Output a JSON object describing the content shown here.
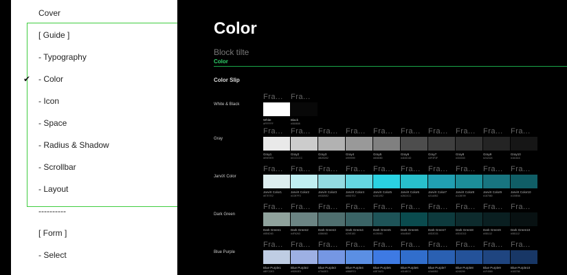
{
  "menu": {
    "items": [
      {
        "label": "Cover",
        "checked": false
      },
      {
        "label": "[ Guide ]",
        "checked": false
      },
      {
        "label": "- Typography",
        "checked": false
      },
      {
        "label": "- Color",
        "checked": true
      },
      {
        "label": "- Icon",
        "checked": false
      },
      {
        "label": "- Space",
        "checked": false
      },
      {
        "label": "- Radius & Shadow",
        "checked": false
      },
      {
        "label": "- Scrollbar",
        "checked": false
      },
      {
        "label": "- Layout",
        "checked": false
      },
      {
        "label": "----------",
        "checked": false
      },
      {
        "label": "[ Form ]",
        "checked": false
      },
      {
        "label": "- Select",
        "checked": false
      }
    ],
    "check_mark": "✔"
  },
  "page": {
    "title": "Color",
    "block_title": "Block tilte",
    "block_subtitle": "Color",
    "section_title": "Color Slip"
  },
  "frame_label": "Fra...",
  "groups": [
    {
      "label": "White & Black",
      "swatches": [
        {
          "name": "White",
          "hex": "#FFFFFF",
          "color": "#FFFFFF"
        },
        {
          "name": "Black",
          "hex": "#080808",
          "color": "#080808"
        }
      ]
    },
    {
      "label": "Gray",
      "swatches": [
        {
          "name": "Gray1",
          "hex": "#E9E9E9",
          "color": "#E9E9E9"
        },
        {
          "name": "Gray2",
          "hex": "#CCCCCC",
          "color": "#CCCCCC"
        },
        {
          "name": "Gray3",
          "hex": "#B2B2B2",
          "color": "#B2B2B2"
        },
        {
          "name": "Gray4",
          "hex": "#999999",
          "color": "#999999"
        },
        {
          "name": "Gray5",
          "hex": "#808080",
          "color": "#808080"
        },
        {
          "name": "Gray6",
          "hex": "#4D4D4D",
          "color": "#4D4D4D"
        },
        {
          "name": "Gray7",
          "hex": "#3F3F3F",
          "color": "#3F3F3F"
        },
        {
          "name": "Gray8",
          "hex": "#333333",
          "color": "#333333"
        },
        {
          "name": "Gray9",
          "hex": "#242424",
          "color": "#242424"
        },
        {
          "name": "Gray10",
          "hex": "#161616",
          "color": "#161616"
        }
      ]
    },
    {
      "label": "JarviX Color",
      "swatches": [
        {
          "name": "JarviX Color1",
          "hex": "#E7E7E2",
          "color": "#DDEEEF"
        },
        {
          "name": "JarviX Color2",
          "hex": "#C0EFF2",
          "color": "#C0EFF2"
        },
        {
          "name": "JarviX Color3",
          "hex": "#93DBE2",
          "color": "#93DBE2"
        },
        {
          "name": "JarviX Color4",
          "hex": "#65D7E2",
          "color": "#65D7E2"
        },
        {
          "name": "JarviX Color5",
          "hex": "#2AD2E2",
          "color": "#2AD2E2"
        },
        {
          "name": "JarviX Color6",
          "hex": "#28C0CC",
          "color": "#28C0CC"
        },
        {
          "name": "JarviX Color7",
          "hex": "#21A0B2",
          "color": "#21A0B2"
        },
        {
          "name": "JarviX Color8",
          "hex": "#1C8E99",
          "color": "#1C8E99"
        },
        {
          "name": "JarviX Color9",
          "hex": "#187580",
          "color": "#187580"
        },
        {
          "name": "JarviX Color10",
          "hex": "#105E66",
          "color": "#105E66"
        }
      ]
    },
    {
      "label": "Dark Green",
      "swatches": [
        {
          "name": "Dark Green1",
          "hex": "#5E6D63",
          "color": "#8FA29C"
        },
        {
          "name": "Dark Green2",
          "hex": "#4F6263",
          "color": "#6B8483"
        },
        {
          "name": "Dark Green3",
          "hex": "#386063",
          "color": "#4F6F6F"
        },
        {
          "name": "Dark Green4",
          "hex": "#20E183",
          "color": "#3A6466"
        },
        {
          "name": "Dark Green5",
          "hex": "#135063",
          "color": "#1E5458"
        },
        {
          "name": "Dark Green6",
          "hex": "#0A4B4E",
          "color": "#0A4B4E"
        },
        {
          "name": "Dark Green7",
          "hex": "#0D2D31",
          "color": "#0D3A3D"
        },
        {
          "name": "Dark Green8",
          "hex": "#0D1D1D",
          "color": "#0D2B2D"
        },
        {
          "name": "Dark Green9",
          "hex": "#081112",
          "color": "#0A1F21"
        },
        {
          "name": "Dark Green10",
          "hex": "#081112",
          "color": "#081112"
        }
      ]
    },
    {
      "label": "Blue Purple",
      "swatches": [
        {
          "name": "Blue Purple1",
          "hex": "#BFCDE3",
          "color": "#BFCDE3"
        },
        {
          "name": "Blue Purple2",
          "hex": "#9DB0E3",
          "color": "#9DB0E3"
        },
        {
          "name": "Blue Purple3",
          "hex": "#70A3E3",
          "color": "#7597E3"
        },
        {
          "name": "Blue Purple4",
          "hex": "#5B8FE3",
          "color": "#5B8FE3"
        },
        {
          "name": "Blue Purple5",
          "hex": "#3E7AE3",
          "color": "#3E7AE3"
        },
        {
          "name": "Blue Purple6",
          "hex": "#316ECC",
          "color": "#316ECC"
        },
        {
          "name": "Blue Purple7",
          "hex": "#2A60B2",
          "color": "#2A60B2"
        },
        {
          "name": "Blue Purple8",
          "hex": "#245299",
          "color": "#245299"
        },
        {
          "name": "Blue Purple9",
          "hex": "#1F4580",
          "color": "#1F4580"
        },
        {
          "name": "Blue Purple10",
          "hex": "#183766",
          "color": "#183766"
        }
      ]
    }
  ]
}
